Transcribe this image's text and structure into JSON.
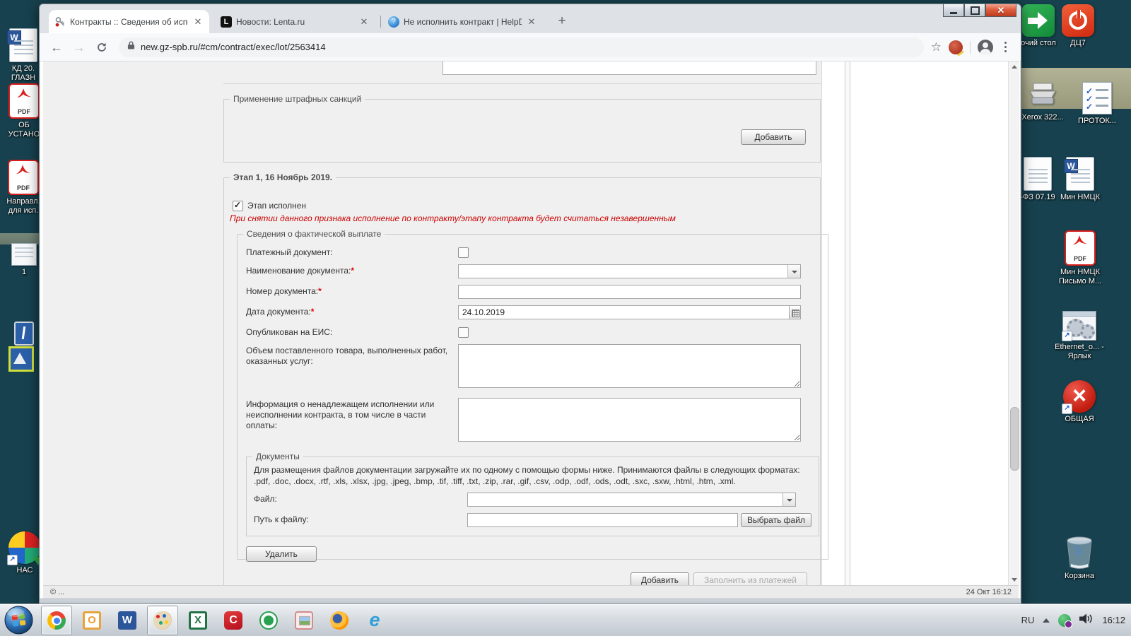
{
  "browser": {
    "tabs": [
      {
        "title": "Контракты :: Сведения об испол",
        "favicon": "key-icon"
      },
      {
        "title": "Новости: Lenta.ru",
        "favicon": "lenta-icon"
      },
      {
        "title": "Не исполнить контракт | HelpDe",
        "favicon": "helpdesk-icon"
      }
    ],
    "url": "new.gz-spb.ru/#cm/contract/exec/lot/2563414"
  },
  "page": {
    "required_marker": "*",
    "penalties": {
      "legend": "Применение штрафных санкций",
      "add_button": "Добавить"
    },
    "stage": {
      "legend": "Этап 1, 16 Ноябрь 2019.",
      "done_label": "Этап исполнен",
      "done_checked": true,
      "warning": "При снятии данного признака исполнение по контракту/этапу контракта будет считаться незавершенным",
      "payment": {
        "legend": "Сведения о фактической выплате",
        "fields": [
          {
            "label": "Платежный документ:",
            "control": "checkbox",
            "required": false
          },
          {
            "label": "Наименование документа:",
            "control": "select",
            "required": true
          },
          {
            "label": "Номер документа:",
            "control": "text",
            "required": true
          },
          {
            "label": "Дата документа:",
            "control": "date",
            "required": true,
            "value": "24.10.2019"
          },
          {
            "label": "Опубликован на ЕИС:",
            "control": "checkbox",
            "required": false
          },
          {
            "label": "Объем поставленного товара, выполненных работ, оказанных услуг:",
            "control": "textarea",
            "required": false
          },
          {
            "label": "Информация о ненадлежащем исполнении или неисполнении контракта, в том числе в части оплаты:",
            "control": "textarea",
            "required": false
          }
        ],
        "docs": {
          "legend": "Документы",
          "hint": "Для размещения файлов документации загружайте их по одному с помощью формы ниже. Принимаются файлы в следующих форматах: .pdf, .doc, .docx, .rtf, .xls, .xlsx, .jpg, .jpeg, .bmp, .tif, .tiff, .txt, .zip, .rar, .gif, .csv, .odp, .odf, .ods, .odt, .sxc, .sxw, .html, .htm, .xml.",
          "file_label": "Файл:",
          "path_label": "Путь к файлу:",
          "choose_button": "Выбрать файл"
        },
        "delete_button": "Удалить"
      },
      "add_button": "Добавить",
      "fill_button": "Заполнить из платежей"
    },
    "status_left": "© ...",
    "status_right": "24 Окт 16:12"
  },
  "desktop": {
    "left_icons": [
      {
        "label": "КД 20. ГЛАЗН",
        "type": "word-doc-icon"
      },
      {
        "label": "ОБ УСТАНО",
        "type": "pdf-icon"
      },
      {
        "label": "Направл. для исп.",
        "type": "pdf-icon"
      },
      {
        "label": "1",
        "type": "window-icon"
      },
      {
        "label": "НАС",
        "type": "app-shortcut-icon"
      }
    ],
    "right_icons": [
      {
        "label": "очий стол",
        "type": "green-arrow-icon"
      },
      {
        "label": "ДЦ7",
        "type": "power-icon"
      },
      {
        "label": "Xerox 322...",
        "type": "printer-icon"
      },
      {
        "label": "ПРОТОК...",
        "type": "checklist-icon"
      },
      {
        "label": "-ФЗ 07.19",
        "type": "doc-icon"
      },
      {
        "label": "Мин НМЦК",
        "type": "word-doc-icon"
      },
      {
        "label": "Мин НМЦК Письмо М...",
        "type": "pdf-icon"
      },
      {
        "label": "Ethernet_o... - Ярлык",
        "type": "gears-icon"
      },
      {
        "label": "ОБЩАЯ",
        "type": "error-icon"
      },
      {
        "label": "Корзина",
        "type": "recycle-bin-icon"
      }
    ]
  },
  "taskbar": {
    "language": "RU",
    "time": "16:12",
    "icons": [
      "start",
      "chrome",
      "outlook",
      "word",
      "paint",
      "excel",
      "consultant",
      "green-app",
      "photo-viewer",
      "firefox",
      "internet-explorer"
    ]
  }
}
